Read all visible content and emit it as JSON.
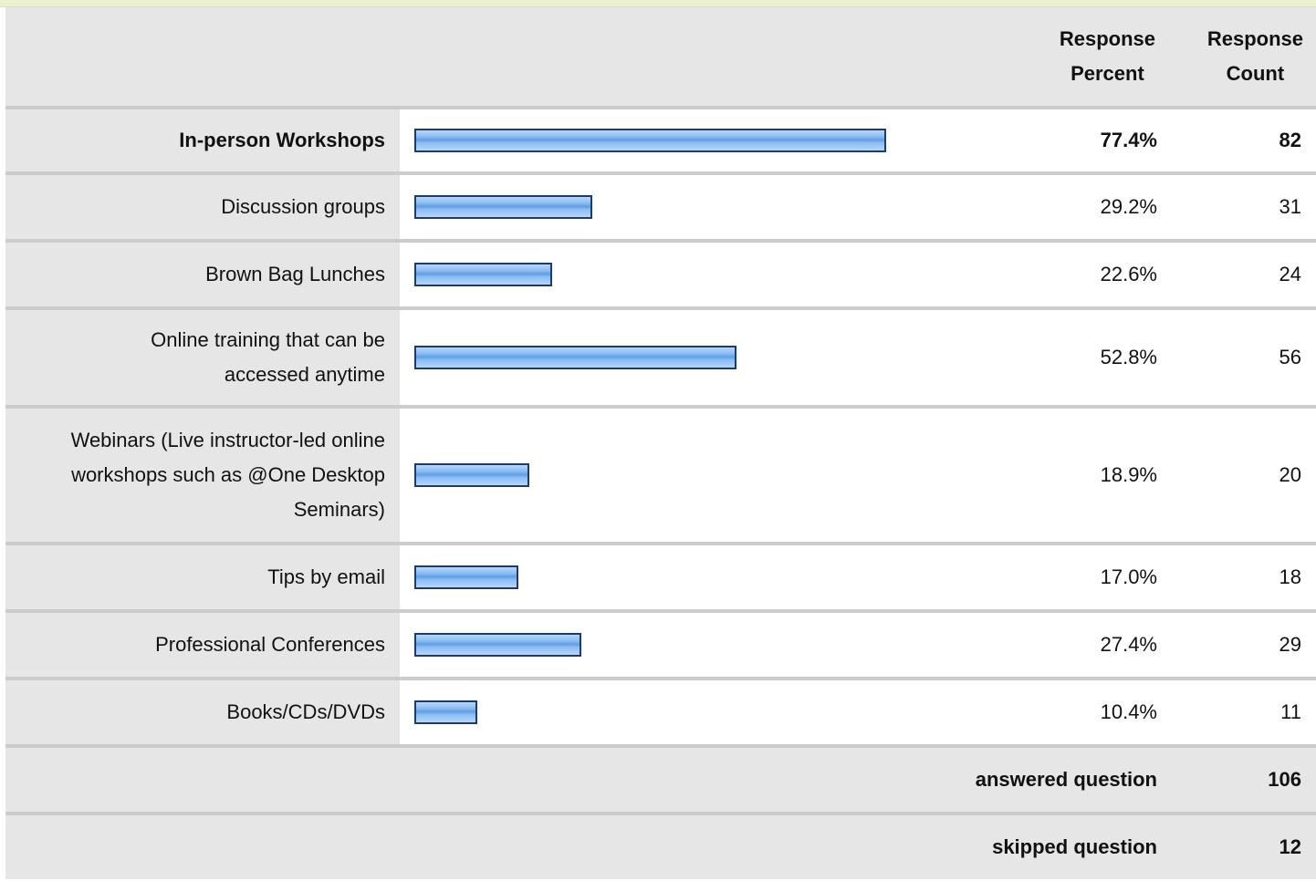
{
  "header": {
    "percent_label_line1": "Response",
    "percent_label_line2": "Percent",
    "count_label_line1": "Response",
    "count_label_line2": "Count"
  },
  "chart_data": {
    "type": "bar",
    "orientation": "horizontal",
    "bar_color": "#8cbdf2",
    "bar_border_color": "#1f3c66",
    "categories": [
      [
        "In-person Workshops"
      ],
      [
        "Discussion groups"
      ],
      [
        "Brown Bag Lunches"
      ],
      [
        "Online training that can be",
        "accessed anytime"
      ],
      [
        "Webinars (Live instructor-led online",
        "workshops such as @One Desktop",
        "Seminars)"
      ],
      [
        "Tips by email"
      ],
      [
        "Professional Conferences"
      ],
      [
        "Books/CDs/DVDs"
      ]
    ],
    "percent_labels": [
      "77.4%",
      "29.2%",
      "22.6%",
      "52.8%",
      "18.9%",
      "17.0%",
      "27.4%",
      "10.4%"
    ],
    "percent_values": [
      77.4,
      29.2,
      22.6,
      52.8,
      18.9,
      17.0,
      27.4,
      10.4
    ],
    "counts": [
      "82",
      "31",
      "24",
      "56",
      "20",
      "18",
      "29",
      "11"
    ],
    "highlighted_index": 0,
    "xlim": [
      0,
      100
    ]
  },
  "summary": {
    "answered_label": "answered question",
    "answered_value": "106",
    "skipped_label": "skipped question",
    "skipped_value": "12"
  },
  "colors": {
    "header_bg": "#e6e6e6",
    "top_band": "#eaf2d2",
    "row_separator": "#cccccc"
  }
}
